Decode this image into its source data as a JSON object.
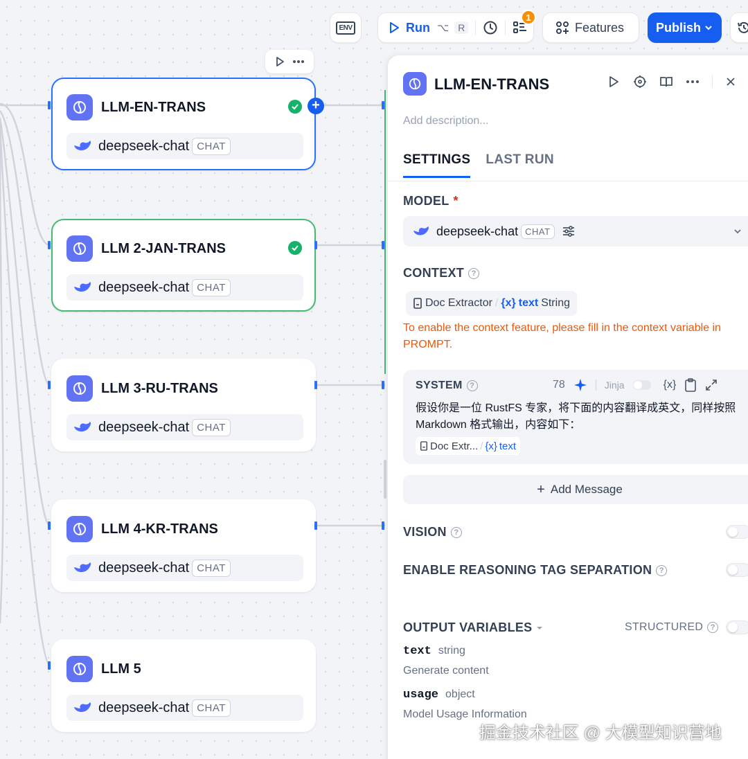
{
  "toolbar": {
    "env_label": "ENV",
    "run_label": "Run",
    "run_shortcut_1": "⌥",
    "run_shortcut_2": "R",
    "checklist_badge": "1",
    "features_label": "Features",
    "publish_label": "Publish"
  },
  "nodes": [
    {
      "title": "LLM-EN-TRANS",
      "model": "deepseek-chat",
      "mode": "CHAT"
    },
    {
      "title": "LLM 2-JAN-TRANS",
      "model": "deepseek-chat",
      "mode": "CHAT"
    },
    {
      "title": "LLM 3-RU-TRANS",
      "model": "deepseek-chat",
      "mode": "CHAT"
    },
    {
      "title": "LLM 4-KR-TRANS",
      "model": "deepseek-chat",
      "mode": "CHAT"
    },
    {
      "title": "LLM 5",
      "model": "deepseek-chat",
      "mode": "CHAT"
    }
  ],
  "panel": {
    "title": "LLM-EN-TRANS",
    "description_placeholder": "Add description...",
    "tabs": [
      {
        "label": "SETTINGS"
      },
      {
        "label": "LAST RUN"
      }
    ],
    "model_label": "MODEL",
    "model_required": "*",
    "model_name": "deepseek-chat",
    "model_mode": "CHAT",
    "context_label": "CONTEXT",
    "context_node": "Doc Extractor",
    "context_var": "text",
    "context_type": "String",
    "context_warning": "To enable the context feature, please fill in the context variable in PROMPT.",
    "system_label": "SYSTEM",
    "system_count": "78",
    "jinja_label": "Jinja",
    "var_icon": "{x}",
    "system_text": "假设你是一位 RustFS 专家，将下面的内容翻译成英文，同样按照 Markdown 格式输出，内容如下：",
    "system_chip_node": "Doc Extr...",
    "system_chip_var": "text",
    "add_message_label": "Add Message",
    "vision_label": "VISION",
    "reasoning_label": "ENABLE REASONING TAG SEPARATION",
    "output_label": "OUTPUT VARIABLES",
    "structured_label": "STRUCTURED",
    "outputs": [
      {
        "name": "text",
        "type": "string",
        "description": "Generate content"
      },
      {
        "name": "usage",
        "type": "object",
        "description": "Model Usage Information"
      }
    ]
  },
  "watermark": "掘金技术社区 @ 大模型知识营地",
  "colors": {
    "accent": "#155eef",
    "success": "#17b26a",
    "node_icon": "#6172f3",
    "warning": "#e8590c",
    "badge": "#f79009"
  }
}
